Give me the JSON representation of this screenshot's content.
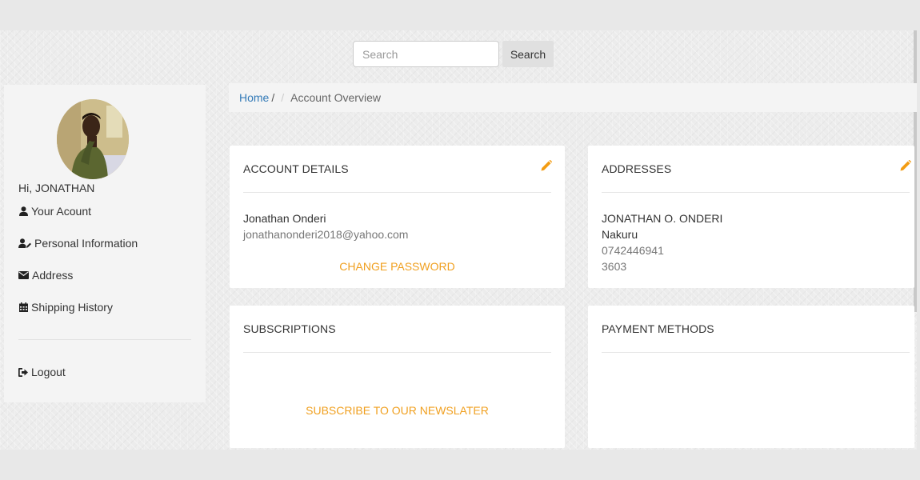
{
  "search": {
    "placeholder": "Search",
    "button_label": "Search"
  },
  "sidebar": {
    "greeting": "Hi, JONATHAN",
    "items": [
      {
        "label": "Your Acount",
        "icon": "user-icon"
      },
      {
        "label": "Personal Information",
        "icon": "user-edit-icon"
      },
      {
        "label": "Address",
        "icon": "envelope-icon"
      },
      {
        "label": "Shipping History",
        "icon": "calendar-icon"
      },
      {
        "label": "Logout",
        "icon": "sign-out-icon"
      }
    ]
  },
  "breadcrumb": {
    "home": "Home",
    "separator": "/",
    "current": "Account Overview"
  },
  "cards": {
    "account": {
      "title": "ACCOUNT DETAILS",
      "name": "Jonathan Onderi",
      "email": "jonathanonderi2018@yahoo.com",
      "action": "CHANGE PASSWORD"
    },
    "addresses": {
      "title": "ADDRESSES",
      "name": "JONATHAN O. ONDERI",
      "city": "Nakuru",
      "phone": "0742446941",
      "code": "3603"
    },
    "subscriptions": {
      "title": "SUBSCRIPTIONS",
      "action": "SUBSCRIBE TO OUR NEWSLATER"
    },
    "payment": {
      "title": "PAYMENT METHODS"
    }
  },
  "colors": {
    "accent": "#f0a020",
    "link": "#337ab7",
    "edit_icon": "#f39c12"
  }
}
